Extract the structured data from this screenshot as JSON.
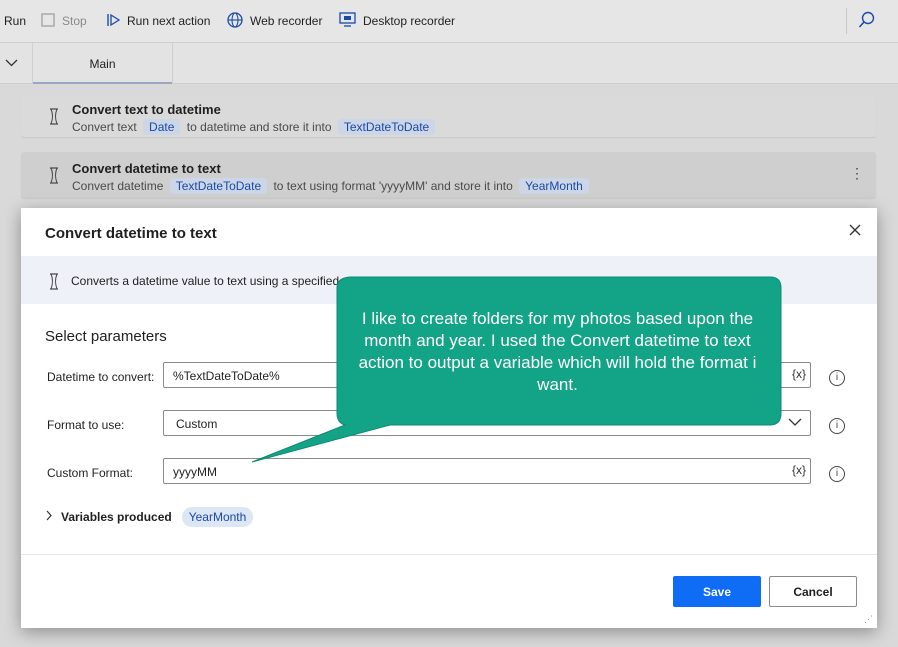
{
  "toolbar": {
    "run": "Run",
    "stop": "Stop",
    "run_next": "Run next action",
    "web_recorder": "Web recorder",
    "desktop_recorder": "Desktop recorder"
  },
  "tabs": {
    "main": "Main"
  },
  "actions": [
    {
      "title": "Convert text to datetime",
      "desc_1": "Convert text",
      "var_1": "Date",
      "desc_2": "to datetime and store it into",
      "var_2": "TextDateToDate"
    },
    {
      "title": "Convert datetime to text",
      "desc_1": "Convert datetime",
      "var_1": "TextDateToDate",
      "desc_2": "to text using format 'yyyyMM' and store it into",
      "var_2": "YearMonth"
    }
  ],
  "dialog": {
    "title": "Convert datetime to text",
    "info": "Converts a datetime value to text using a specified",
    "section": "Select parameters",
    "fields": {
      "datetime_label": "Datetime to convert:",
      "datetime_value": "%TextDateToDate%",
      "format_label": "Format to use:",
      "format_value": "Custom",
      "custom_label": "Custom Format:",
      "custom_value": "yyyyMM",
      "var_button": "{x}"
    },
    "variables_label": "Variables produced",
    "variables_value": "YearMonth",
    "save": "Save",
    "cancel": "Cancel"
  },
  "callout": {
    "text": "I like to create folders for my photos based upon the month and year.  I used the Convert datetime to text action to output a variable which will hold the format i want.",
    "color": "#13a386"
  }
}
